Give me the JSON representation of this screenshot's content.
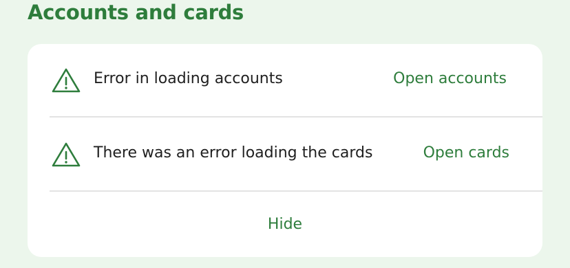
{
  "section": {
    "title": "Accounts and cards"
  },
  "rows": [
    {
      "icon": "warning-triangle-icon",
      "message": "Error in loading accounts",
      "link_label": "Open accounts"
    },
    {
      "icon": "warning-triangle-icon",
      "message": "There was an error loading the cards",
      "link_label": "Open cards"
    }
  ],
  "hide_label": "Hide",
  "colors": {
    "accent": "#2e7d3c",
    "background": "#ecf6ec",
    "card": "#ffffff",
    "text": "#1f1f1f",
    "divider": "#e3e3e3"
  }
}
